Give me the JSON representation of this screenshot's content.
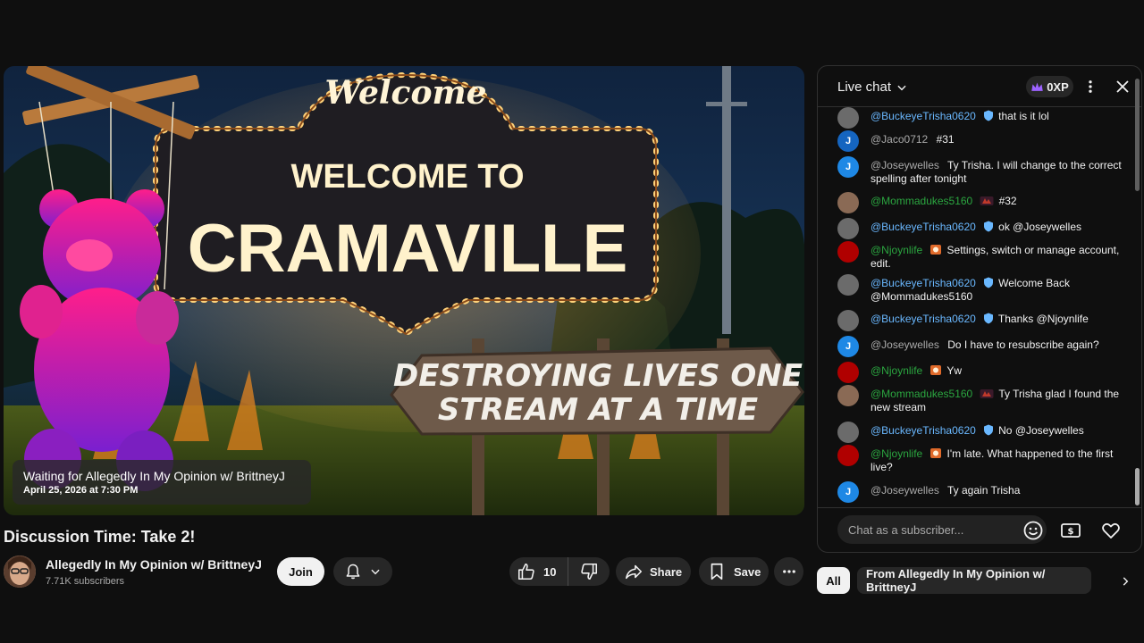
{
  "video": {
    "sign_top": "Welcome",
    "sign_line1": "WELCOME TO",
    "sign_line2": "CRAMAVILLE",
    "arrow_line1": "DESTROYING LIVES ONE",
    "arrow_line2": "STREAM AT A TIME",
    "waiting_title": "Waiting for Allegedly In My Opinion w/ BrittneyJ",
    "waiting_date": "April 25, 2026 at 7:30 PM"
  },
  "title": "Discussion Time: Take 2!",
  "channel": {
    "name": "Allegedly In My Opinion w/ BrittneyJ",
    "subscribers": "7.71K subscribers"
  },
  "actions": {
    "join": "Join",
    "likes": "10",
    "share": "Share",
    "save": "Save"
  },
  "chat": {
    "title": "Live chat",
    "xp": "0XP",
    "input_placeholder": "Chat as a subscriber...",
    "messages": [
      {
        "author": "@BuckeyeTrisha0620",
        "text": "that is it lol"
      },
      {
        "author": "@Jaco0712",
        "text": "#31",
        "initial": "J"
      },
      {
        "author": "@Joseywelles",
        "text": "Ty Trisha. I will change to the correct spelling after tonight",
        "initial": "J"
      },
      {
        "author": "@Mommadukes5160",
        "text": "#32"
      },
      {
        "author": "@BuckeyeTrisha0620",
        "text": "ok @Joseywelles"
      },
      {
        "author": "@Njoynlife",
        "text": "Settings, switch or manage account, edit."
      },
      {
        "author": "@BuckeyeTrisha0620",
        "text": "Welcome Back @Mommadukes5160"
      },
      {
        "author": "@BuckeyeTrisha0620",
        "text": "Thanks @Njoynlife"
      },
      {
        "author": "@Joseywelles",
        "text": "Do I have to resubscribe again?",
        "initial": "J"
      },
      {
        "author": "@Njoynlife",
        "text": "Yw"
      },
      {
        "author": "@Mommadukes5160",
        "text": "Ty Trisha glad I found the new stream"
      },
      {
        "author": "@BuckeyeTrisha0620",
        "text": "No @Joseywelles"
      },
      {
        "author": "@Njoynlife",
        "text": "I'm late. What happened to the first live?"
      },
      {
        "author": "@Joseywelles",
        "text": "Ty again Trisha",
        "initial": "J"
      }
    ]
  },
  "chips": {
    "all": "All",
    "channel": "From Allegedly In My Opinion w/ BrittneyJ"
  },
  "colors": {
    "background": "#0f0f0f",
    "pill": "#272727",
    "moderator_blue": "#6ab8ff",
    "member_green": "#2ba640",
    "neon_gold": "#ffd27a"
  }
}
